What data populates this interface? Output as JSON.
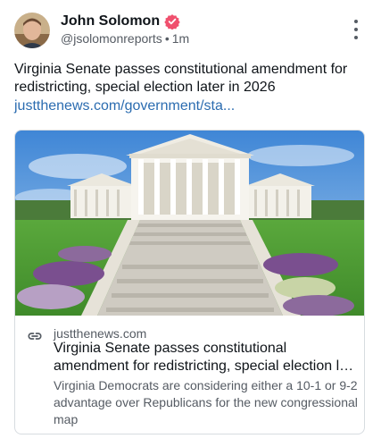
{
  "post": {
    "author": {
      "display_name": "John Solomon",
      "handle": "@jsolomonreports",
      "separator": "•",
      "timestamp": "1m",
      "verified": true,
      "badge_color": "#f0506e"
    },
    "text": "Virginia Senate passes constitutional amendment for redistricting, special election later in 2026",
    "link_text": "justthenews.com/government/sta..."
  },
  "card": {
    "domain": "justthenews.com",
    "title_line1": "Virginia Senate passes constitutional",
    "title_line2": "amendment for redistricting, special election la...",
    "description": "Virginia Democrats are considering either a 10-1 or 9-2 advantage over Republicans for the new congressional map"
  },
  "icons": {
    "more": "more-vertical-icon",
    "verified": "verified-badge-icon",
    "link": "link-icon"
  },
  "colors": {
    "link": "#2b6cb0",
    "muted": "#555b63",
    "border": "#d7dce0"
  }
}
